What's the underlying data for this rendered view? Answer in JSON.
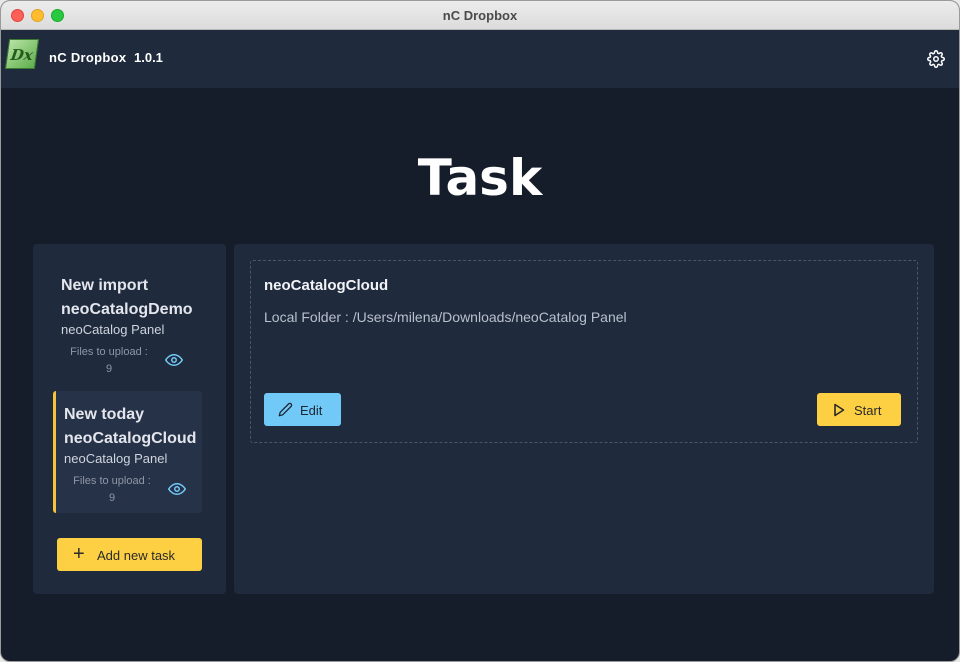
{
  "window": {
    "title": "nC Dropbox"
  },
  "appbar": {
    "name": "nC Dropbox",
    "version": "1.0.1",
    "logo_text": "Dx",
    "settings_icon": "gear-icon"
  },
  "page": {
    "title": "Task"
  },
  "tasks": [
    {
      "name": "New import neoCatalogDemo",
      "panel": "neoCatalog Panel",
      "files_label": "Files to upload :",
      "files_count": "9",
      "active": false
    },
    {
      "name": "New today neoCatalogCloud",
      "panel": "neoCatalog Panel",
      "files_label": "Files to upload :",
      "files_count": "9",
      "active": true
    }
  ],
  "add_task": {
    "label": "Add new task"
  },
  "detail": {
    "name": "neoCatalogCloud",
    "folder": "Local Folder : /Users/milena/Downloads/neoCatalog Panel",
    "edit_label": "Edit",
    "start_label": "Start"
  },
  "colors": {
    "accent_yellow": "#fdd044",
    "accent_blue": "#71c9f7",
    "active_border": "#f5c33b",
    "background": "#161d2a",
    "panel": "#1f2a3d"
  }
}
